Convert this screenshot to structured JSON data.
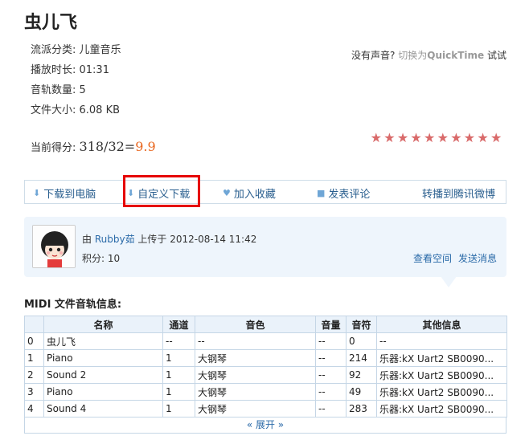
{
  "title": "虫儿飞",
  "meta": {
    "genre": "流派分类: 儿童音乐",
    "duration": "播放时长: 01:31",
    "tracks": "音轨数量: 5",
    "size": "文件大小: 6.08 KB"
  },
  "sound_hint": {
    "question": "没有声音?",
    "switch": "切换为",
    "qt": "QuickTime",
    "try": "试试"
  },
  "score": {
    "label": "当前得分: ",
    "fraction": "318/32=",
    "value": "9.9",
    "stars": [
      "★",
      "★",
      "★",
      "★",
      "★",
      "★",
      "★",
      "★",
      "★",
      "★"
    ]
  },
  "actions": {
    "download_pc": "下载到电脑",
    "custom_download": "自定义下载",
    "favorite": "加入收藏",
    "comment": "发表评论",
    "share_weibo": "转播到腾讯微博"
  },
  "uploader": {
    "by": "由",
    "user": "Rubby茹",
    "uploaded_at": "上传于 2012-08-14 11:42",
    "points": "积分: 10",
    "view_space": "查看空间",
    "send_message": "发送消息"
  },
  "midi": {
    "title": "MIDI 文件音轨信息:",
    "headers": [
      "",
      "名称",
      "通道",
      "音色",
      "音量",
      "音符",
      "其他信息"
    ],
    "rows": [
      [
        "0",
        "虫儿飞",
        "--",
        "--",
        "--",
        "0",
        "--"
      ],
      [
        "1",
        "Piano",
        "1",
        "大钢琴",
        "--",
        "214",
        "乐器:kX Uart2 SB0090..."
      ],
      [
        "2",
        "Sound 2",
        "1",
        "大钢琴",
        "--",
        "92",
        "乐器:kX Uart2 SB0090..."
      ],
      [
        "3",
        "Piano",
        "1",
        "大钢琴",
        "--",
        "49",
        "乐器:kX Uart2 SB0090..."
      ],
      [
        "4",
        "Sound 4",
        "1",
        "大钢琴",
        "--",
        "283",
        "乐器:kX Uart2 SB0090..."
      ]
    ],
    "expand": "« 展开 »"
  },
  "colors": {
    "link": "#2a6aa8",
    "score_value": "#e8641b",
    "highlight": "#e60000",
    "star": "#d96a6a"
  }
}
